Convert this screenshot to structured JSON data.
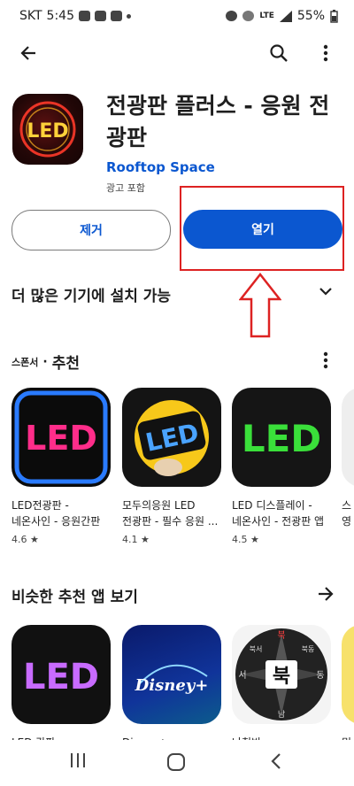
{
  "status": {
    "carrier": "SKT",
    "time": "5:45",
    "battery": "55%",
    "network": "LTE"
  },
  "app": {
    "title": "전광판 플러스 - 응원 전광판",
    "developer": "Rooftop Space",
    "ads_label": "광고 포함",
    "icon_text": "LED"
  },
  "buttons": {
    "remove": "제거",
    "open": "열기"
  },
  "sections": {
    "more_devices": "더 많은 기기에 설치 가능",
    "sponsored_small": "스폰서",
    "sponsored_dot": "·",
    "recommended": "추천",
    "similar": "비슷한 추천 앱 보기"
  },
  "recommended_apps": [
    {
      "name_line1": "LED전광판 -",
      "name_line2": "네온사인 - 응원간판",
      "rating": "4.6",
      "icon_text": "LED"
    },
    {
      "name_line1": "모두의응원 LED",
      "name_line2": "전광판 - 필수 응원 ...",
      "rating": "4.1",
      "icon_text": "LED"
    },
    {
      "name_line1": "LED 디스플레이 -",
      "name_line2": "네온사인 - 전광판 앱",
      "rating": "4.5",
      "icon_text": "LED"
    },
    {
      "name_line1": "스",
      "name_line2": "영",
      "rating": ""
    }
  ],
  "similar_apps": [
    {
      "name": "LED 간판",
      "icon_text": "LED"
    },
    {
      "name": "Disney+",
      "icon_text": "Disney+"
    },
    {
      "name": "나침반",
      "icon_text": "북"
    },
    {
      "name": "믿"
    }
  ],
  "compass_labels": [
    "서",
    "북서",
    "북",
    "북동",
    "동",
    "남"
  ],
  "colors": {
    "accent": "#0b57d0",
    "annotation": "#dd2222"
  }
}
